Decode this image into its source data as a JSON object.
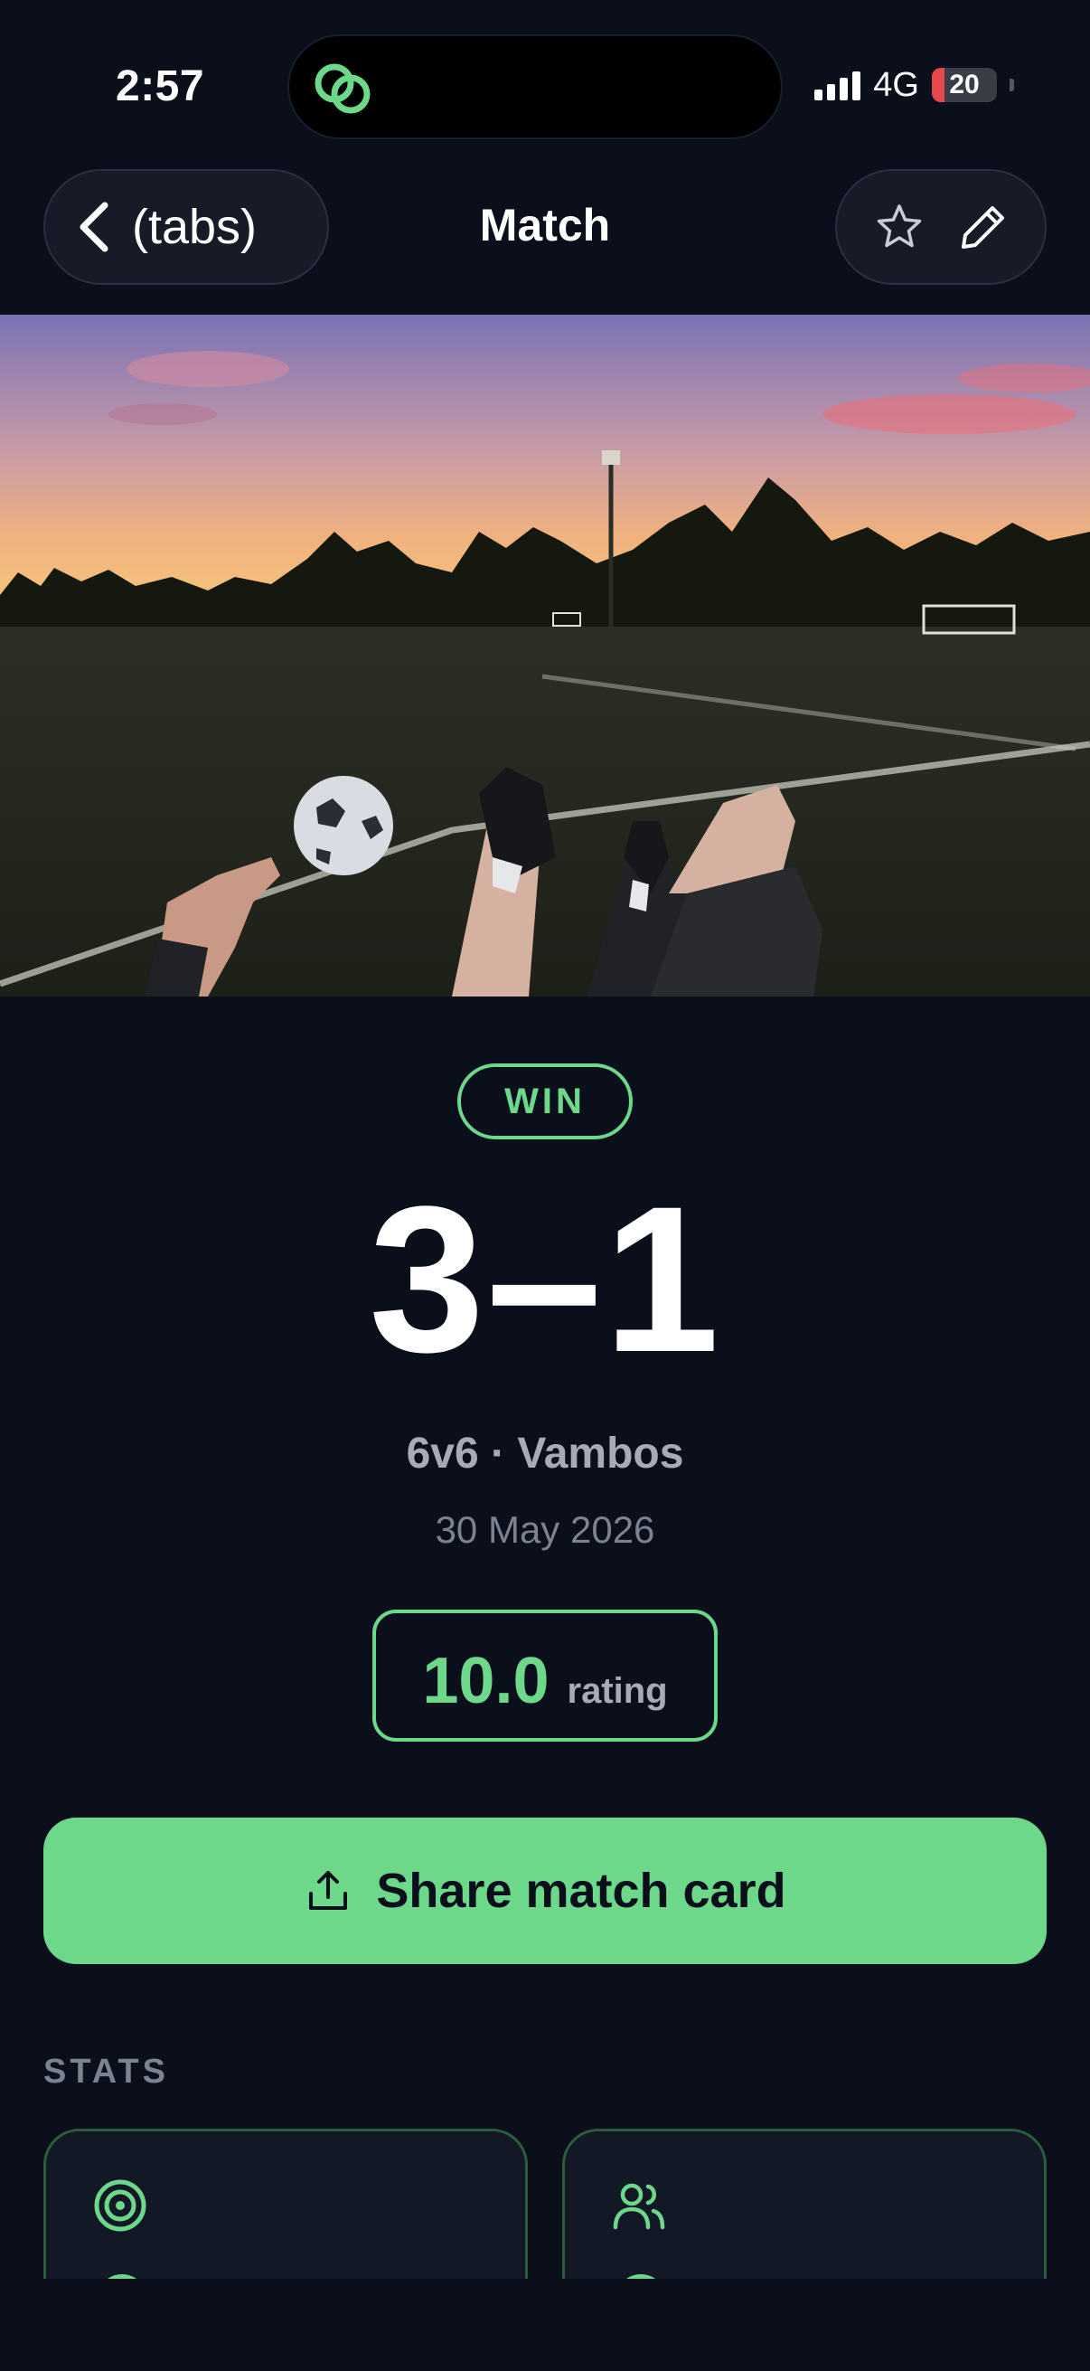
{
  "status_bar": {
    "time": "2:57",
    "network": "4G",
    "battery": "20",
    "battery_level": 0.2
  },
  "nav": {
    "back_label": "(tabs)",
    "title": "Match"
  },
  "match": {
    "result": "WIN",
    "score": "3–1",
    "meta": "6v6 · Vambos",
    "date": "30 May 2026",
    "rating_value": "10.0",
    "rating_label": "rating"
  },
  "share": {
    "label": "Share match card"
  },
  "stats": {
    "section_label": "STATS"
  },
  "icons": {
    "island": "chain-link-app-icon",
    "back": "chevron-left-icon",
    "favorite": "star-icon",
    "edit": "pencil-icon",
    "share": "upload-icon",
    "stat_left": "target-icon",
    "stat_right": "users-icon"
  },
  "colors": {
    "background": "#0b0f1c",
    "accent": "#6ed88a",
    "muted": "#a7abb6",
    "battery_low": "#e5484d"
  }
}
